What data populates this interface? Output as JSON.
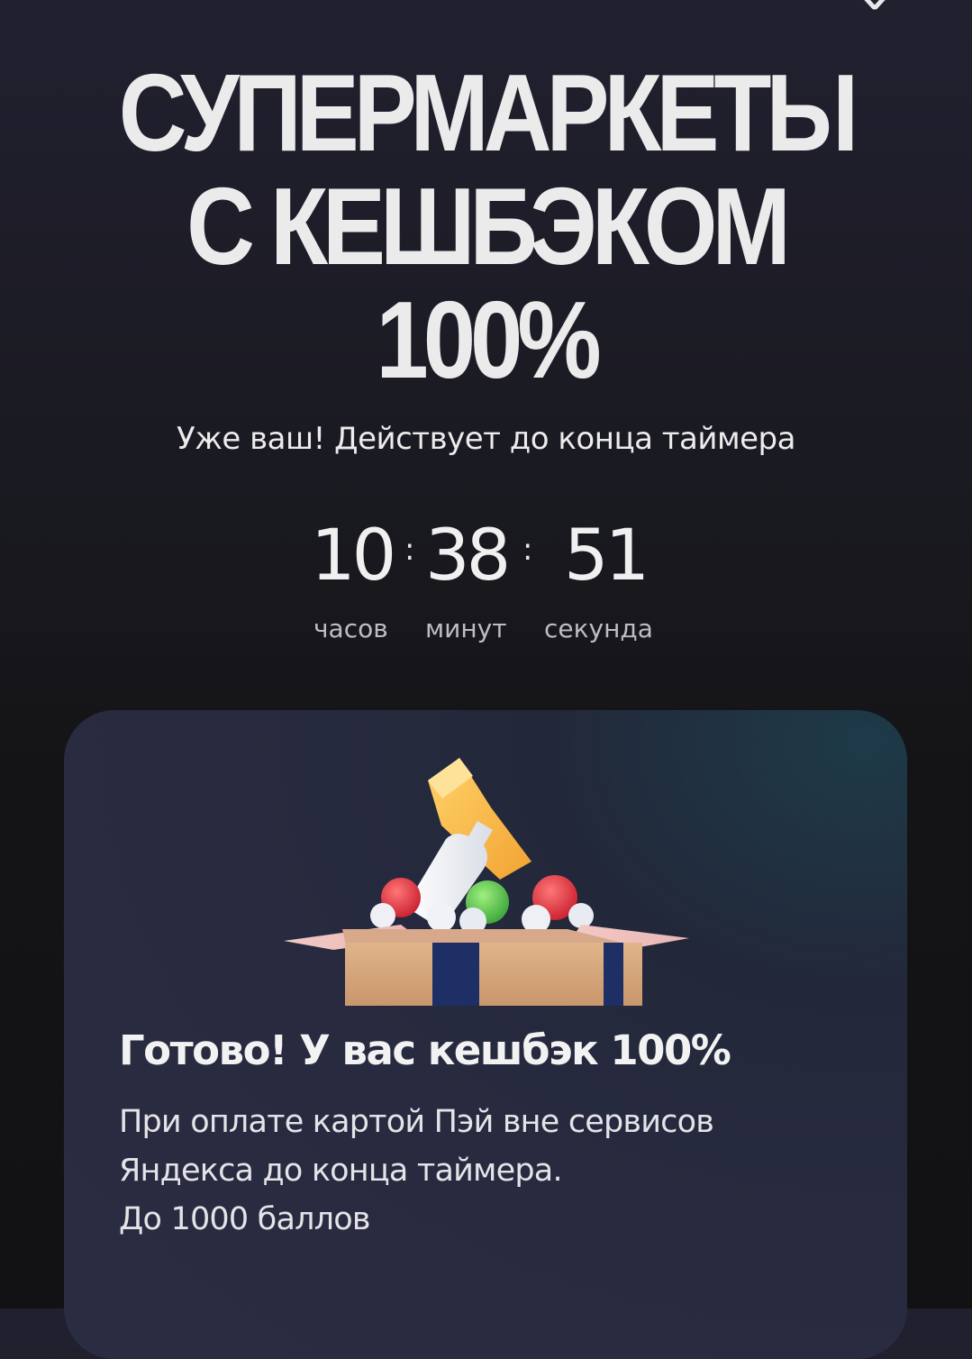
{
  "header": {
    "close_icon": "close-icon",
    "title_lines": [
      "СУПЕРМАРКЕТЫ",
      "С КЕШБЭКОМ",
      "100%"
    ],
    "subtitle": "Уже ваш! Действует до конца таймера"
  },
  "timer": {
    "hours": "10",
    "minutes": "38",
    "seconds": "51",
    "separator": ":",
    "hours_label": "часов",
    "minutes_label": "минут",
    "seconds_label": "секунда"
  },
  "card": {
    "illustration": "grocery-box-illustration",
    "title": "Готово! У вас кешбэк 100%",
    "body_lines": [
      "При оплате картой Пэй вне сервисов",
      "Яндекса до конца таймера.",
      "До 1000 баллов"
    ]
  }
}
